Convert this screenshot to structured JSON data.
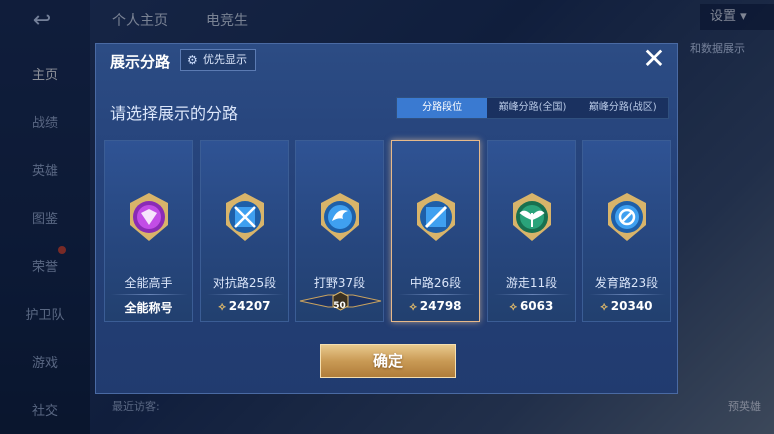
{
  "sidebar": {
    "items": [
      {
        "label": "主页",
        "active": true
      },
      {
        "label": "战绩",
        "active": false
      },
      {
        "label": "英雄",
        "active": false
      },
      {
        "label": "图鉴",
        "active": false
      },
      {
        "label": "荣誉",
        "active": false
      },
      {
        "label": "护卫队",
        "active": false
      },
      {
        "label": "游戏",
        "active": false
      },
      {
        "label": "社交",
        "active": false
      }
    ]
  },
  "background": {
    "tab_profile": "个人主页",
    "tab_second": "电竞生",
    "settings_label": "设置",
    "recent_visitors": "最近访客:",
    "hero_button": "预英雄",
    "data_display": "和数据展示"
  },
  "modal": {
    "title": "展示分路",
    "priority_label": "优先显示",
    "close_symbol": "✕",
    "prompt": "请选择展示的分路",
    "tabs": [
      "分路段位",
      "巅峰分路(全国)",
      "巅峰分路(战区)"
    ],
    "active_tab": 0,
    "confirm_label": "确定"
  },
  "cards": [
    {
      "name": "全能高手",
      "value": "全能称号",
      "emblem": "all-round-emblem-icon",
      "color": "#b23bd6",
      "selected": false,
      "points": false
    },
    {
      "name": "对抗路25段",
      "value": "24207",
      "emblem": "clash-lane-emblem-icon",
      "color": "#2f8fe0",
      "selected": false,
      "points": true
    },
    {
      "name": "打野37段",
      "value": "50",
      "emblem": "jungle-emblem-icon",
      "color": "#2f8fe0",
      "selected": false,
      "points": false
    },
    {
      "name": "中路26段",
      "value": "24798",
      "emblem": "mid-lane-emblem-icon",
      "color": "#2f8fe0",
      "selected": true,
      "points": true
    },
    {
      "name": "游走11段",
      "value": "6063",
      "emblem": "roam-emblem-icon",
      "color": "#2aa37a",
      "selected": false,
      "points": true
    },
    {
      "name": "发育路23段",
      "value": "20340",
      "emblem": "farm-lane-emblem-icon",
      "color": "#2f8fe0",
      "selected": false,
      "points": true
    }
  ],
  "colors": {
    "accent_tab": "#3a7ad1",
    "gold": "#c99a55",
    "modal_bg": "#25427a"
  }
}
